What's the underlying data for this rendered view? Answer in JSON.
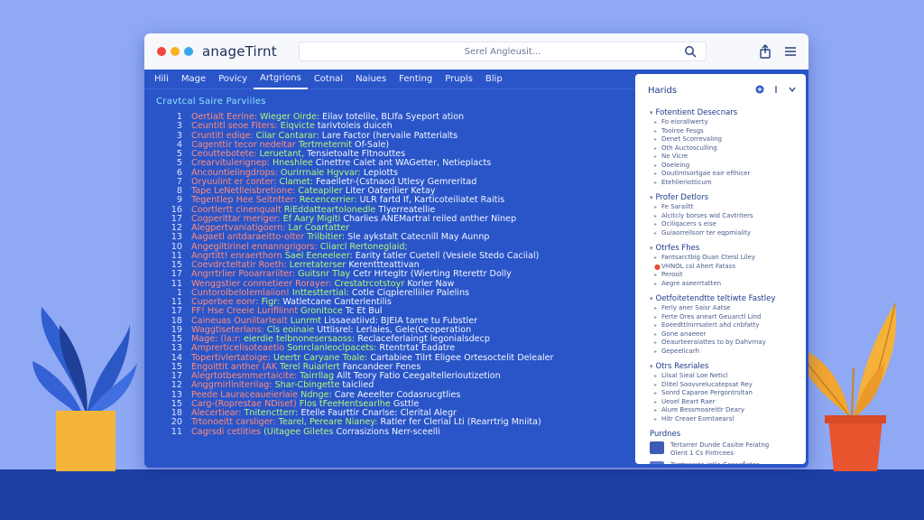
{
  "colors": {
    "background": "#8fa9f4",
    "window_body": "#2a55c8",
    "dot_red": "#ef4a3c",
    "dot_yellow": "#f5b324",
    "dot_blue": "#3aa7e8"
  },
  "app": {
    "title": "anageTirnt"
  },
  "search": {
    "text": "Serel Angleusit...",
    "icon": "search-icon"
  },
  "toolbar": {
    "icons": [
      "share-icon",
      "menu-icon"
    ]
  },
  "menu": {
    "items": [
      {
        "label": "Hili"
      },
      {
        "label": "Mage"
      },
      {
        "label": "Povicy"
      },
      {
        "label": "Artgrions"
      },
      {
        "label": "Cotnal"
      },
      {
        "label": "Naiues"
      },
      {
        "label": "Fenting"
      },
      {
        "label": "Prupls"
      },
      {
        "label": "Blip"
      }
    ]
  },
  "editor": {
    "section_title": "Cravtcal Saire Parviiles",
    "lines": [
      {
        "n": "1",
        "parts": [
          "Oertialt Eerine:",
          " Wieger Oirde:",
          " Eilav totelile, BLIfa Syeport ation"
        ]
      },
      {
        "n": "3",
        "parts": [
          "Ceuntitl seoe Fiters:",
          " Eiqvicte",
          " tarivtoleis duiceh"
        ]
      },
      {
        "n": "3",
        "parts": [
          "Cruntitl ediqe:",
          " Cilar Cantarar:",
          " Lare Factor (hervaile Patterialts"
        ]
      },
      {
        "n": "4",
        "parts": [
          "Cagenttir tecor nedeltar",
          " Tertmeternit",
          " Of-Sale)"
        ]
      },
      {
        "n": "5",
        "parts": [
          "Ceouttebotete:",
          " Leruetant,",
          " Tensietoalte Fltnouttes"
        ]
      },
      {
        "n": "5",
        "parts": [
          "Crearvitulerignep:",
          " Hneshlee",
          " Cinettre Calet ant WAGetter, Netieplacts"
        ]
      },
      {
        "n": "6",
        "parts": [
          "Ancountielingdrops:",
          " Ourirrnale Hgvvar:",
          " Lepiotts"
        ]
      },
      {
        "n": "7",
        "parts": [
          "Oryuulint er conter:",
          " Clamet:",
          " Feaelletr-(Cstnaod Utlesy Gemreritad"
        ]
      },
      {
        "n": "8",
        "parts": [
          "Tape LeNetlleisbretione:",
          " Cateapiler",
          " Liter Oaterilier Ketay"
        ]
      },
      {
        "n": "9",
        "parts": [
          "Tegentlep Hee Seitntter:",
          " Recencerrier:",
          " ULR fartd If, Karticoteiliatet Raitis"
        ]
      },
      {
        "n": "16",
        "parts": [
          "Coortlertt cinenqualt",
          " RiEddatteartolonedle",
          " Tlyerreatellie"
        ]
      },
      {
        "n": "17",
        "parts": [
          "Cogperittar meriger:",
          " Ef Aary Migiti",
          " Charlies ANEMartral reiled anther Ninep"
        ]
      },
      {
        "n": "12",
        "parts": [
          "Alegpertvaniatigoern:",
          " Lar Coartatter",
          ""
        ]
      },
      {
        "n": "13",
        "parts": [
          "Aagaetl antdaraeitto-olter",
          " Trilbitier:",
          " Sle aykstalt Catecnill May Aunnp"
        ]
      },
      {
        "n": "10",
        "parts": [
          "Angegiltirinel ennanngrigors:",
          " Cliarcl Rertoneglaid;",
          ""
        ]
      },
      {
        "n": "11",
        "parts": [
          "Angrtitt! enraerthorn",
          " Sael Eeneeleer:",
          " Earity tatler Cuetell (Vesiele Stedo Caciial)"
        ]
      },
      {
        "n": "15",
        "parts": [
          "Coevdrcteltatir Roeth:",
          " Lerretaterser",
          " Kerenttteattivan"
        ]
      },
      {
        "n": "17",
        "parts": [
          "Angrrtrlier Pooarrariiter:",
          " Guitsnr Tlay",
          " Cetr Hrtegltr (Wierting Rterettr Dolly"
        ]
      },
      {
        "n": "11",
        "parts": [
          "Wenggstier conmetieer Rorayer:",
          " Crestatrcotstoyr",
          " Korler Naw"
        ]
      },
      {
        "n": "1",
        "parts": [
          "Cuntorolbelolemlaiion!",
          " Inttesttertial:",
          " Cotle Ciqplerelliiler Palelins"
        ]
      },
      {
        "n": "11",
        "parts": [
          "Cuperbee eonr:",
          " Figr:",
          " Watletcane Canterlentilis"
        ]
      },
      {
        "n": "17",
        "parts": [
          "FF! Hse Creeie Lurifilinnt",
          " Gronitoce",
          " Tc Et Bul"
        ]
      },
      {
        "n": "18",
        "parts": [
          "Caineuas Ouniltarlealt",
          " Lunrmt",
          " Lissaeatiivd: BJEIA tame tu Fubstler"
        ]
      },
      {
        "n": "19",
        "parts": [
          "Waggtiseterlans:",
          " Cls eoinaie",
          " Uttlisrel: Lerlaies, Gele(Ceoperation"
        ]
      },
      {
        "n": "15",
        "parts": [
          "Mage: (la:r:",
          " eierdie telbnonesersaoss:",
          " Reclaceferlaingt legonialsdecp"
        ]
      },
      {
        "n": "13",
        "parts": [
          "Amprerticelisoteaetio",
          " Sonrclanleoclpacets:",
          " Rtentrtat Eadatre"
        ]
      },
      {
        "n": "14",
        "parts": [
          "Topertivlertatoige:",
          " Ueertr Caryane Toale:",
          " Cartabiee Tilrt Eligee Ortesoctelit Delealer"
        ]
      },
      {
        "n": "15",
        "parts": [
          "Engoittit anther (AK",
          " Terel Ruiarlert",
          " Fancandeer Fenes"
        ]
      },
      {
        "n": "17",
        "parts": [
          "Alegrtotbesmmertaicite:",
          " Tairrllag",
          " Allt Teory Fatio Ceegaltellerioutizetion"
        ]
      },
      {
        "n": "12",
        "parts": [
          "Anggrnirliniterilag:",
          " Shar-Cbingette",
          " taiclied"
        ]
      },
      {
        "n": "13",
        "parts": [
          "Peede Lauraceaueierlaie",
          " Ndnge:",
          " Care Aeeelter Codasrucgtlies"
        ]
      },
      {
        "n": "15",
        "parts": [
          "Carg-(Roprestae NDiset)",
          " Flos tFeeHentsearlhe",
          " Gsttle"
        ]
      },
      {
        "n": "18",
        "parts": [
          "Alecertiear:",
          " Tnitenctterr:",
          " Etelle Faurttir Cnarlse: Clerital Alegr"
        ]
      },
      {
        "n": "20",
        "parts": [
          "Trtonoeitt carsliger:",
          " Tearel, Pereare Nianey:",
          " Ratler fer Clerial Lti (Rearrtrig Mniita)"
        ]
      },
      {
        "n": "11",
        "parts": [
          "Cagrsdi cetlities",
          " (Uitagee Giletes",
          " Corrasizions Nerr-sceelli"
        ]
      }
    ]
  },
  "panel": {
    "title": "Harids",
    "icons": [
      "add-icon",
      "filter-icon",
      "more-icon"
    ],
    "groups": [
      {
        "head": "Fotentient Desecnars",
        "items": [
          "Fo eiorallwerty",
          "Tooiroe Fesgs",
          "Denet Scorrevaling",
          "Oth Auctosculling",
          "Ne Vicre",
          "Ooeleing",
          "Ooutlmlsortgae eair efihicer",
          "Etehlieriotticum"
        ]
      },
      {
        "head": "Profer Detlors",
        "items": [
          "Fe Sarailtt",
          "Alcitcly borses wid Cavtriters",
          "Ociliqacers s eise",
          "Guiaorrellsorr ter eqpmiality"
        ]
      },
      {
        "head": "Otrfes Fhes",
        "items": [
          "Fantsarctbig Ouan Cteisl Liley",
          "VHNOL csl Ahert Fatass",
          "Perosit",
          "Aegre aseerrtatten"
        ]
      },
      {
        "head": "Oetfoitetendtte teltiwte Fastley",
        "items": [
          "Ferly aner Saisr Aatse",
          "Ferte Ores aneart Geuarctl Lind",
          "Eoeedttlnirrsatert ahd cnbfatty",
          "Gone anaeeer",
          "Oeaurteeralattes to by Dahvrnay",
          "Gepeelicarh"
        ]
      },
      {
        "head": "Otrs Resriales",
        "items": [
          "Llisal Sieal Loe Neticl",
          "Dlitel Soovvrelucatepsat Rey",
          "Sonrd Caparoe Pergontrsltan",
          "Ueoel Beart Raer",
          "Alure Bessmoareitlr Deary",
          "Hitr Creaer Eomtaearsl"
        ]
      }
    ],
    "recent": {
      "head": "Purdnes",
      "rows": [
        {
          "lines": [
            "Tertarrer Dunde Casitie Feiatng",
            "Olent 1 Cs Fintrcees"
          ]
        },
        {
          "lines": [
            "Tarrtserate intle Gosacfletes",
            "Geecsly en Cerblsedeer cin"
          ]
        }
      ]
    }
  }
}
